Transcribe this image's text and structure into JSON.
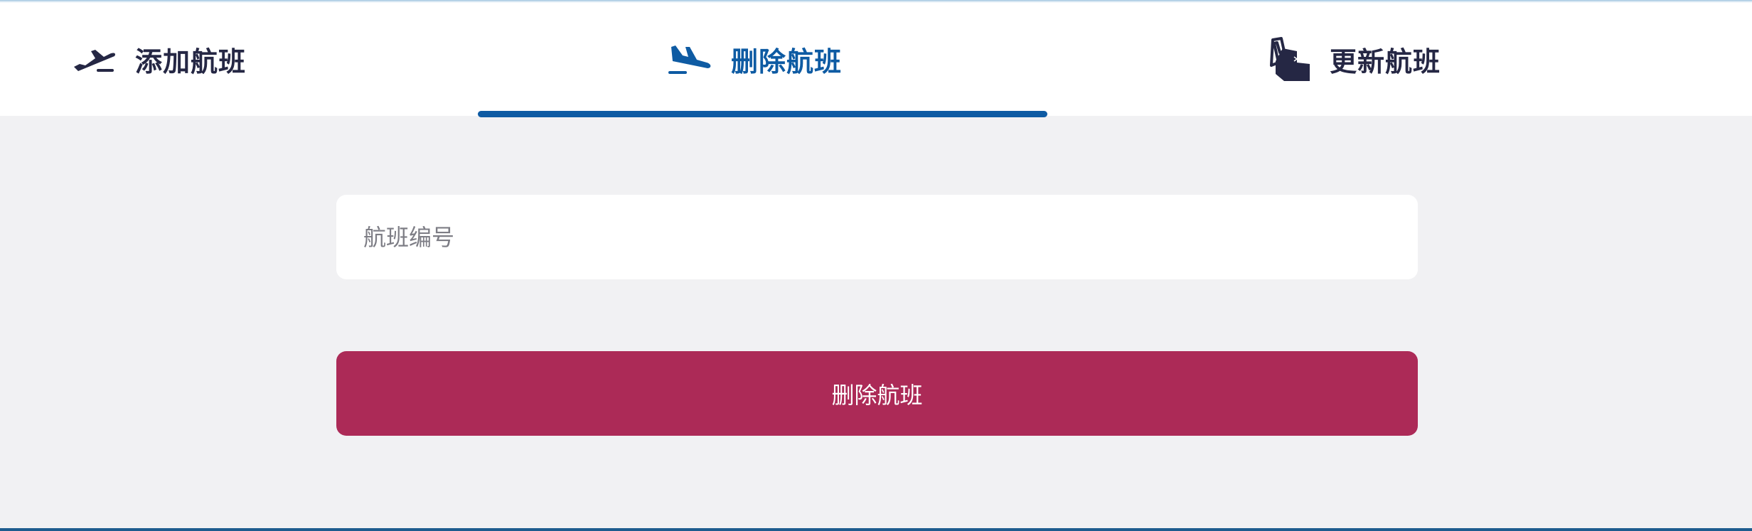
{
  "tabs": [
    {
      "label": "添加航班",
      "icon": "airplane-takeoff-icon",
      "active": false
    },
    {
      "label": "删除航班",
      "icon": "airplane-landing-icon",
      "active": true
    },
    {
      "label": "更新航班",
      "icon": "boarding-pass-hand-icon",
      "active": false
    }
  ],
  "form": {
    "flight_number_placeholder": "航班编号",
    "flight_number_value": "",
    "submit_label": "删除航班"
  },
  "colors": {
    "accent": "#0e5ba3",
    "tab_text": "#252744",
    "button": "#ac2a57",
    "background": "#f1f1f3"
  }
}
